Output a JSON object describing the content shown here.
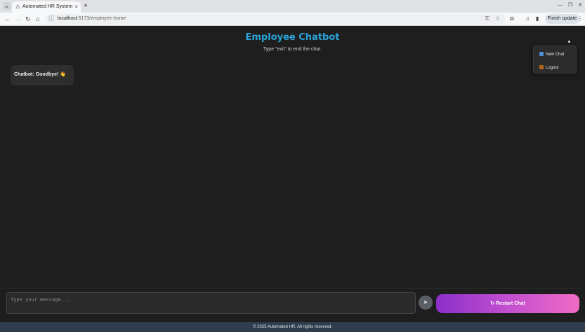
{
  "browser": {
    "tab_title": "Automated HR System",
    "url_host": "localhost",
    "url_path": ":5173/employee-home",
    "finish_update_label": "Finish update"
  },
  "header": {
    "title": "Employee Chatbot",
    "subtitle": "Type \"exit\" to end the chat."
  },
  "menu": {
    "items": [
      {
        "label": "New Chat",
        "icon": "new-chat-icon"
      },
      {
        "label": "Logout",
        "icon": "logout-icon"
      }
    ]
  },
  "messages": [
    {
      "sender": "Chatbot",
      "text": "Chatbot: Goodbye! 👋"
    }
  ],
  "composer": {
    "placeholder": "Type your message...",
    "send_icon": "➤",
    "restart_label": "↻ Restart Chat"
  },
  "footer": {
    "text": "© 2025 Automated HR. All rights reserved."
  },
  "colors": {
    "title": "#2aa4d8",
    "page_bg": "#1e1e1e",
    "restart_gradient_start": "#8b2fc9",
    "restart_gradient_end": "#f06ac4",
    "footer_bg": "#2f3e4e"
  }
}
